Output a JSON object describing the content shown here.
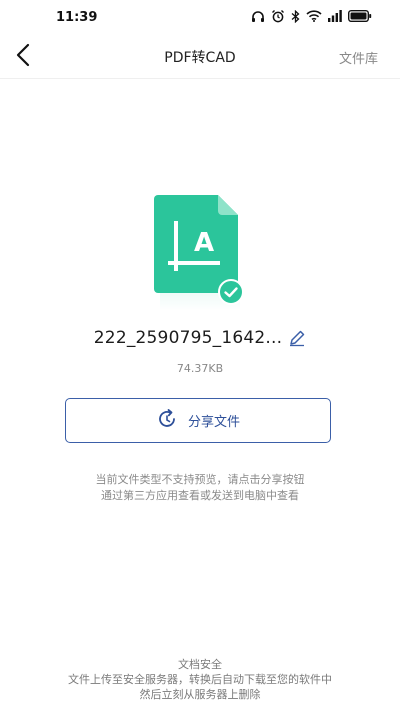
{
  "status_bar": {
    "time": "11:39",
    "icons": [
      "headphones-icon",
      "alarm-icon",
      "bluetooth-icon",
      "wifi-icon",
      "signal-icon",
      "battery-icon"
    ]
  },
  "nav": {
    "title": "PDF转CAD",
    "right_link": "文件库",
    "back_icon": "chevron-left-icon"
  },
  "file": {
    "icon": "cad-file-icon",
    "name": "222_2590795_1642...",
    "size": "74.37KB",
    "status_icon": "check-circle-icon",
    "edit_icon": "pencil-icon"
  },
  "share": {
    "label": "分享文件",
    "icon": "share-refresh-icon"
  },
  "hint": {
    "line1": "当前文件类型不支持预览，请点击分享按钮",
    "line2": "通过第三方应用查看或发送到电脑中查看"
  },
  "footer": {
    "title": "文档安全",
    "line1": "文件上传至安全服务器，转换后自动下载至您的软件中",
    "line2": "然后立刻从服务器上删除"
  },
  "colors": {
    "accent_green": "#2bc59b",
    "accent_blue": "#2d4f99"
  }
}
